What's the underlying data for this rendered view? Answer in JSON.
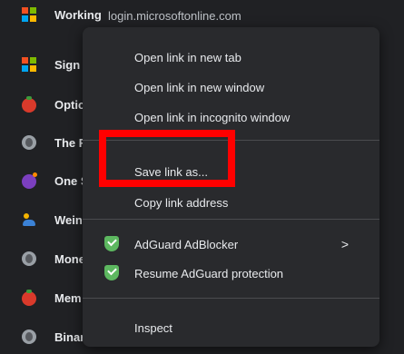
{
  "bookmarks": {
    "items": [
      {
        "label": "Working",
        "icon": "microsoft-logo-icon"
      },
      {
        "label": "Sign",
        "icon": "microsoft-logo-icon"
      },
      {
        "label": "Optic",
        "icon": "tomato-icon"
      },
      {
        "label": "The F",
        "icon": "globe-icon"
      },
      {
        "label": "One S",
        "icon": "bomb-icon"
      },
      {
        "label": "Wein",
        "icon": "people-icon"
      },
      {
        "label": "Mone",
        "icon": "globe-icon"
      },
      {
        "label": "Mem",
        "icon": "tomato-icon"
      },
      {
        "label": "Binar",
        "icon": "globe-icon"
      }
    ],
    "url_hint": "login.microsoftonline.com"
  },
  "context_menu": {
    "open_new_tab": "Open link in new tab",
    "open_new_window": "Open link in new window",
    "open_incognito": "Open link in incognito window",
    "save_link_as": "Save link as...",
    "copy_link": "Copy link address",
    "adguard_blocker": "AdGuard AdBlocker",
    "adguard_resume": "Resume AdGuard protection",
    "inspect": "Inspect",
    "submenu_arrow": ">"
  },
  "colors": {
    "background": "#202124",
    "menu": "#292a2d",
    "highlight": "#ff0000",
    "adguard_green": "#5db860"
  }
}
